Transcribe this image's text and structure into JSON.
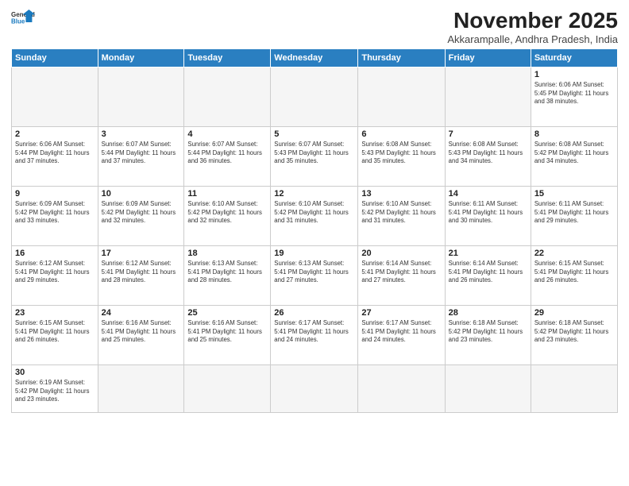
{
  "header": {
    "logo_general": "General",
    "logo_blue": "Blue",
    "month_title": "November 2025",
    "location": "Akkarampalle, Andhra Pradesh, India"
  },
  "days_of_week": [
    "Sunday",
    "Monday",
    "Tuesday",
    "Wednesday",
    "Thursday",
    "Friday",
    "Saturday"
  ],
  "weeks": [
    [
      {
        "day": "",
        "info": ""
      },
      {
        "day": "",
        "info": ""
      },
      {
        "day": "",
        "info": ""
      },
      {
        "day": "",
        "info": ""
      },
      {
        "day": "",
        "info": ""
      },
      {
        "day": "",
        "info": ""
      },
      {
        "day": "1",
        "info": "Sunrise: 6:06 AM\nSunset: 5:45 PM\nDaylight: 11 hours\nand 38 minutes."
      }
    ],
    [
      {
        "day": "2",
        "info": "Sunrise: 6:06 AM\nSunset: 5:44 PM\nDaylight: 11 hours\nand 37 minutes."
      },
      {
        "day": "3",
        "info": "Sunrise: 6:07 AM\nSunset: 5:44 PM\nDaylight: 11 hours\nand 37 minutes."
      },
      {
        "day": "4",
        "info": "Sunrise: 6:07 AM\nSunset: 5:44 PM\nDaylight: 11 hours\nand 36 minutes."
      },
      {
        "day": "5",
        "info": "Sunrise: 6:07 AM\nSunset: 5:43 PM\nDaylight: 11 hours\nand 35 minutes."
      },
      {
        "day": "6",
        "info": "Sunrise: 6:08 AM\nSunset: 5:43 PM\nDaylight: 11 hours\nand 35 minutes."
      },
      {
        "day": "7",
        "info": "Sunrise: 6:08 AM\nSunset: 5:43 PM\nDaylight: 11 hours\nand 34 minutes."
      },
      {
        "day": "8",
        "info": "Sunrise: 6:08 AM\nSunset: 5:42 PM\nDaylight: 11 hours\nand 34 minutes."
      }
    ],
    [
      {
        "day": "9",
        "info": "Sunrise: 6:09 AM\nSunset: 5:42 PM\nDaylight: 11 hours\nand 33 minutes."
      },
      {
        "day": "10",
        "info": "Sunrise: 6:09 AM\nSunset: 5:42 PM\nDaylight: 11 hours\nand 32 minutes."
      },
      {
        "day": "11",
        "info": "Sunrise: 6:10 AM\nSunset: 5:42 PM\nDaylight: 11 hours\nand 32 minutes."
      },
      {
        "day": "12",
        "info": "Sunrise: 6:10 AM\nSunset: 5:42 PM\nDaylight: 11 hours\nand 31 minutes."
      },
      {
        "day": "13",
        "info": "Sunrise: 6:10 AM\nSunset: 5:42 PM\nDaylight: 11 hours\nand 31 minutes."
      },
      {
        "day": "14",
        "info": "Sunrise: 6:11 AM\nSunset: 5:41 PM\nDaylight: 11 hours\nand 30 minutes."
      },
      {
        "day": "15",
        "info": "Sunrise: 6:11 AM\nSunset: 5:41 PM\nDaylight: 11 hours\nand 29 minutes."
      }
    ],
    [
      {
        "day": "16",
        "info": "Sunrise: 6:12 AM\nSunset: 5:41 PM\nDaylight: 11 hours\nand 29 minutes."
      },
      {
        "day": "17",
        "info": "Sunrise: 6:12 AM\nSunset: 5:41 PM\nDaylight: 11 hours\nand 28 minutes."
      },
      {
        "day": "18",
        "info": "Sunrise: 6:13 AM\nSunset: 5:41 PM\nDaylight: 11 hours\nand 28 minutes."
      },
      {
        "day": "19",
        "info": "Sunrise: 6:13 AM\nSunset: 5:41 PM\nDaylight: 11 hours\nand 27 minutes."
      },
      {
        "day": "20",
        "info": "Sunrise: 6:14 AM\nSunset: 5:41 PM\nDaylight: 11 hours\nand 27 minutes."
      },
      {
        "day": "21",
        "info": "Sunrise: 6:14 AM\nSunset: 5:41 PM\nDaylight: 11 hours\nand 26 minutes."
      },
      {
        "day": "22",
        "info": "Sunrise: 6:15 AM\nSunset: 5:41 PM\nDaylight: 11 hours\nand 26 minutes."
      }
    ],
    [
      {
        "day": "23",
        "info": "Sunrise: 6:15 AM\nSunset: 5:41 PM\nDaylight: 11 hours\nand 26 minutes."
      },
      {
        "day": "24",
        "info": "Sunrise: 6:16 AM\nSunset: 5:41 PM\nDaylight: 11 hours\nand 25 minutes."
      },
      {
        "day": "25",
        "info": "Sunrise: 6:16 AM\nSunset: 5:41 PM\nDaylight: 11 hours\nand 25 minutes."
      },
      {
        "day": "26",
        "info": "Sunrise: 6:17 AM\nSunset: 5:41 PM\nDaylight: 11 hours\nand 24 minutes."
      },
      {
        "day": "27",
        "info": "Sunrise: 6:17 AM\nSunset: 5:41 PM\nDaylight: 11 hours\nand 24 minutes."
      },
      {
        "day": "28",
        "info": "Sunrise: 6:18 AM\nSunset: 5:42 PM\nDaylight: 11 hours\nand 23 minutes."
      },
      {
        "day": "29",
        "info": "Sunrise: 6:18 AM\nSunset: 5:42 PM\nDaylight: 11 hours\nand 23 minutes."
      }
    ],
    [
      {
        "day": "30",
        "info": "Sunrise: 6:19 AM\nSunset: 5:42 PM\nDaylight: 11 hours\nand 23 minutes."
      },
      {
        "day": "",
        "info": ""
      },
      {
        "day": "",
        "info": ""
      },
      {
        "day": "",
        "info": ""
      },
      {
        "day": "",
        "info": ""
      },
      {
        "day": "",
        "info": ""
      },
      {
        "day": "",
        "info": ""
      }
    ]
  ]
}
